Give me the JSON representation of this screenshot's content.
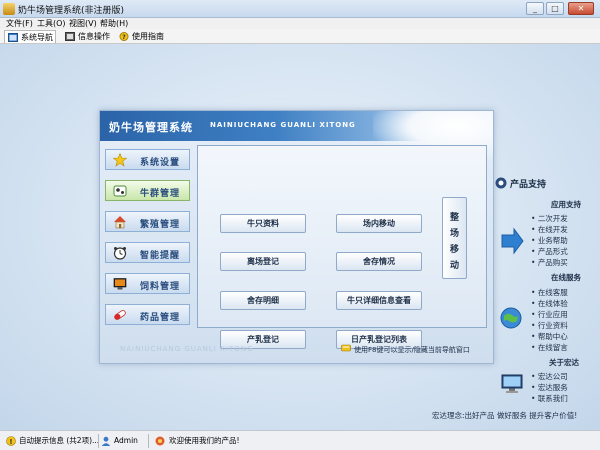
{
  "window": {
    "title": "奶牛场管理系统(非注册版)",
    "minimize": "_",
    "maximize": "□",
    "close": "✕"
  },
  "menu": [
    "文件(F)",
    "工具(O)",
    "视图(V)",
    "帮助(H)"
  ],
  "toolbar": {
    "tabs": [
      {
        "label": "系统导航",
        "icon": "navigation-icon"
      },
      {
        "label": "信息操作",
        "icon": "info-operation-icon"
      },
      {
        "label": "使用指南",
        "icon": "help-icon"
      }
    ]
  },
  "dialog": {
    "title": "奶牛场管理系统",
    "subtitle": "NAINIUCHANG GUANLI XITONG",
    "watermark": "NAINIUCHANG GUANLI XITONG",
    "hint": "使用F8键可以显示/隐藏当前导航窗口",
    "sidebar": [
      {
        "label": "系统设置",
        "icon": "star-icon"
      },
      {
        "label": "牛群管理",
        "icon": "cow-icon"
      },
      {
        "label": "繁殖管理",
        "icon": "house-icon"
      },
      {
        "label": "智能提醒",
        "icon": "alarm-icon"
      },
      {
        "label": "饲料管理",
        "icon": "monitor-icon"
      },
      {
        "label": "药品管理",
        "icon": "pill-icon"
      }
    ],
    "buttons": {
      "cattle_info": "牛只资料",
      "pen_transfer": "场内移动",
      "departure_register": "离场登记",
      "inventory": "舍存情况",
      "pen_detail": "舍存明细",
      "cattle_detail_query": "牛只详细信息查看",
      "milk_register": "产乳登记",
      "daily_milk_list": "日产乳登记列表",
      "group_move": "整场移动"
    }
  },
  "right_panel": {
    "title": "产品支持",
    "sections": [
      {
        "heading": "应用支持",
        "links": [
          "二次开发",
          "在线开发",
          "业务帮助",
          "产品形式",
          "产品购买"
        ]
      },
      {
        "heading": "在线服务",
        "links": [
          "在线客服",
          "在线体验",
          "行业应用",
          "行业资料",
          "帮助中心",
          "在线留言"
        ]
      },
      {
        "heading": "关于宏达",
        "links": [
          "宏达公司",
          "宏达服务",
          "联系我们"
        ]
      }
    ],
    "slogan": "宏达理念:出好产品  做好服务  提升客户价值!"
  },
  "statusbar": {
    "tips": "自动提示信息 (共2项)...",
    "user": "Admin",
    "welcome": "欢迎使用我们的产品!"
  }
}
